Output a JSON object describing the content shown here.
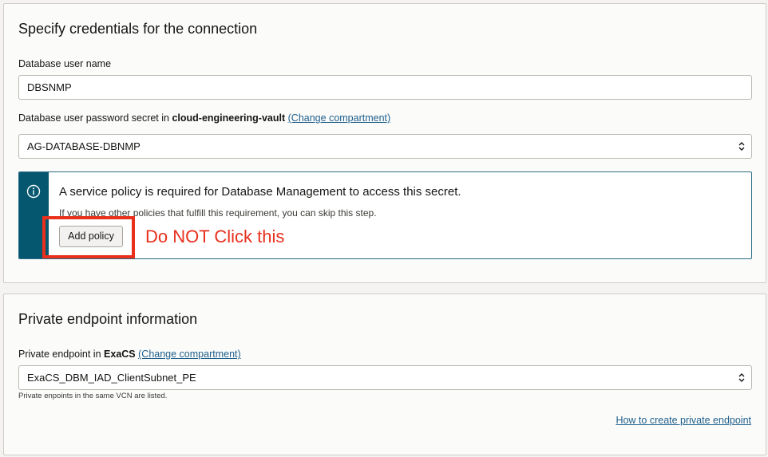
{
  "credentials": {
    "title": "Specify credentials for the connection",
    "username_label": "Database user name",
    "username_value": "DBSNMP",
    "secret_label_prefix": "Database user password secret in",
    "vault_name": "cloud-engineering-vault",
    "change_compartment": "(Change compartment)",
    "secret_value": "AG-DATABASE-DBNMP",
    "policy_notice": {
      "heading": "A service policy is required for Database Management to access this secret.",
      "subtext": "If you have other policies that fulfill this requirement, you can skip this step.",
      "button_label": "Add policy"
    }
  },
  "annotation": {
    "text": "Do NOT Click this",
    "color": "#e8301c"
  },
  "private_endpoint": {
    "title": "Private endpoint information",
    "label_prefix": "Private endpoint in",
    "compartment_name": "ExaCS",
    "change_compartment": "(Change compartment)",
    "value": "ExaCS_DBM_IAD_ClientSubnet_PE",
    "hint": "Private enpoints in the same VCN are listed.",
    "help_link": "How to create private endpoint"
  },
  "icons": {
    "info": "info-circle-icon",
    "select_chevron": "chevron-updown-icon"
  },
  "colors": {
    "accent_stripe": "#055770",
    "link": "#1f5f8b",
    "annotation": "#e8301c"
  }
}
